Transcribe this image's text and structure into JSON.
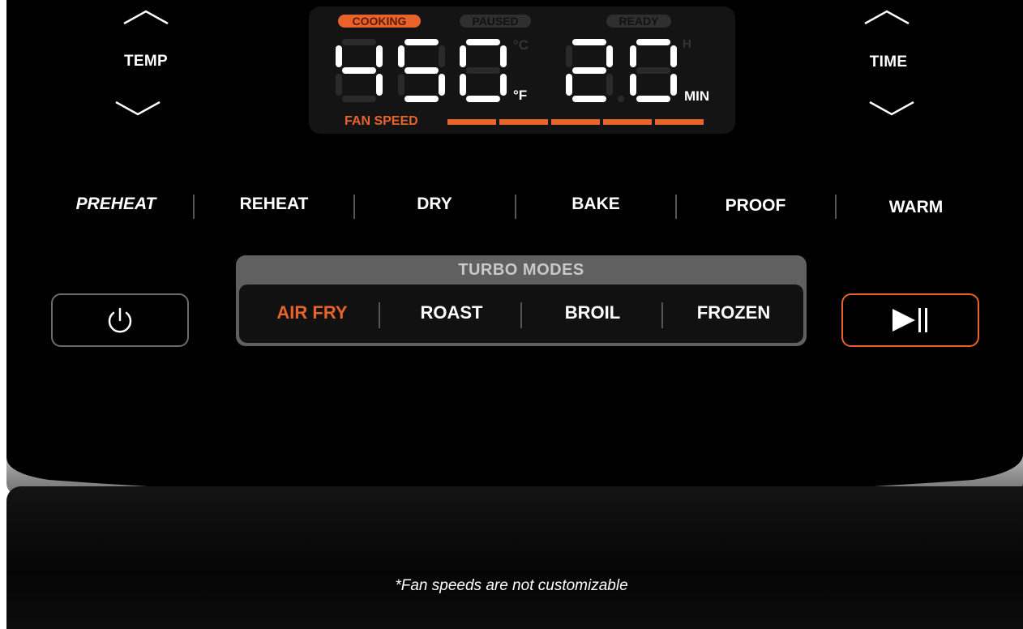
{
  "controls": {
    "temp_label": "TEMP",
    "time_label": "TIME",
    "up_icon": "chevron-up-icon",
    "down_icon": "chevron-down-icon"
  },
  "display": {
    "indicators": {
      "cooking": "COOKING",
      "paused": "PAUSED",
      "ready": "READY"
    },
    "active_indicator": "cooking",
    "temperature_value": "450",
    "time_value": "20",
    "units": {
      "celsius": "°C",
      "fahrenheit": "°F",
      "hours": "H",
      "minutes": "MIN"
    },
    "active_temp_unit": "fahrenheit",
    "active_time_unit": "minutes",
    "fan_speed_label": "FAN SPEED",
    "fan_speed_level": 5,
    "fan_speed_max": 5
  },
  "modes": [
    "PREHEAT",
    "REHEAT",
    "DRY",
    "BAKE",
    "PROOF",
    "WARM"
  ],
  "turbo": {
    "title": "TURBO MODES",
    "items": [
      "AIR FRY",
      "ROAST",
      "BROIL",
      "FROZEN"
    ],
    "active": "AIR FRY"
  },
  "buttons": {
    "power_icon": "power-icon",
    "start_pause_icon": "play-pause-icon"
  },
  "colors": {
    "accent": "#e8632b",
    "panel": "#000000",
    "dim_segment": "#2a2a2a"
  },
  "footnote": "*Fan speeds are not customizable"
}
